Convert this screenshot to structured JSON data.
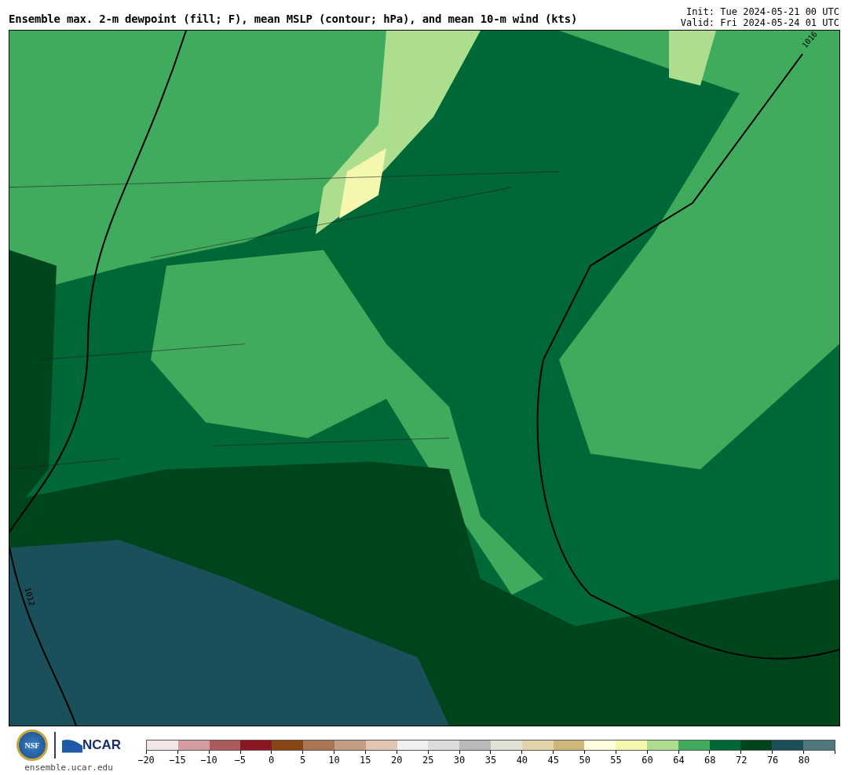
{
  "title": "Ensemble max. 2-m dewpoint (fill; F), mean MSLP (contour; hPa), and mean 10-m wind (kts)",
  "run_info": [
    "Init: Tue 2024-05-21 00 UTC",
    "Valid: Fri 2024-05-24 01 UTC"
  ],
  "map": {
    "contour_labels": [
      "1016",
      "1012"
    ]
  },
  "logos": {
    "nsf": "NSF",
    "ncar": "NCAR",
    "url": "ensemble.ucar.edu"
  },
  "colorbar": {
    "segments": [
      {
        "color": "#f3e6e6"
      },
      {
        "color": "#d39ca1"
      },
      {
        "color": "#ab5a5e"
      },
      {
        "color": "#8b1520"
      },
      {
        "color": "#8b4513"
      },
      {
        "color": "#aa7553"
      },
      {
        "color": "#c49d84"
      },
      {
        "color": "#e0c5b3"
      },
      {
        "color": "#f0f0f0"
      },
      {
        "color": "#dcdcdc"
      },
      {
        "color": "#b9b9b9"
      },
      {
        "color": "#e1e1d4"
      },
      {
        "color": "#e3d3ab"
      },
      {
        "color": "#cdb77a"
      },
      {
        "color": "#ffffe0"
      },
      {
        "color": "#f5f7af"
      },
      {
        "color": "#addd8e"
      },
      {
        "color": "#41ab5d"
      },
      {
        "color": "#006837"
      },
      {
        "color": "#00441b"
      },
      {
        "color": "#1b4f5a"
      },
      {
        "color": "#4f7a7c"
      }
    ],
    "ticks": [
      "−20",
      "−15",
      "−10",
      "−5",
      "0",
      "5",
      "10",
      "15",
      "20",
      "25",
      "30",
      "35",
      "40",
      "45",
      "50",
      "55",
      "60",
      "64",
      "68",
      "72",
      "76",
      "80"
    ]
  }
}
